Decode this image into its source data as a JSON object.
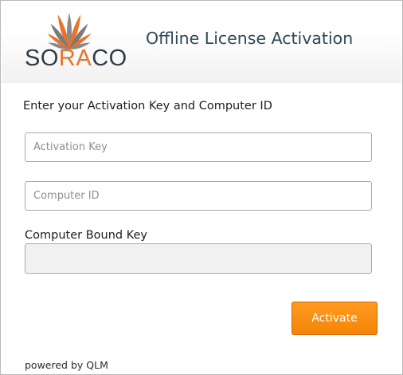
{
  "app": {
    "logo_prefix": "SO",
    "logo_highlight": "RA",
    "logo_suffix": "CO",
    "title": "Offline License Activation"
  },
  "form": {
    "instructions": "Enter your Activation Key and Computer ID",
    "activation_key": {
      "value": "",
      "placeholder": "Activation Key"
    },
    "computer_id": {
      "value": "",
      "placeholder": "Computer ID"
    },
    "bound_key_label": "Computer Bound Key",
    "bound_key_value": ""
  },
  "actions": {
    "activate_label": "Activate"
  },
  "footer": {
    "powered_by": "powered by QLM"
  },
  "colors": {
    "accent": "#f38505",
    "logo_orange": "#e8732a",
    "logo_gray": "#7a7a7a",
    "title": "#2f4a56"
  }
}
